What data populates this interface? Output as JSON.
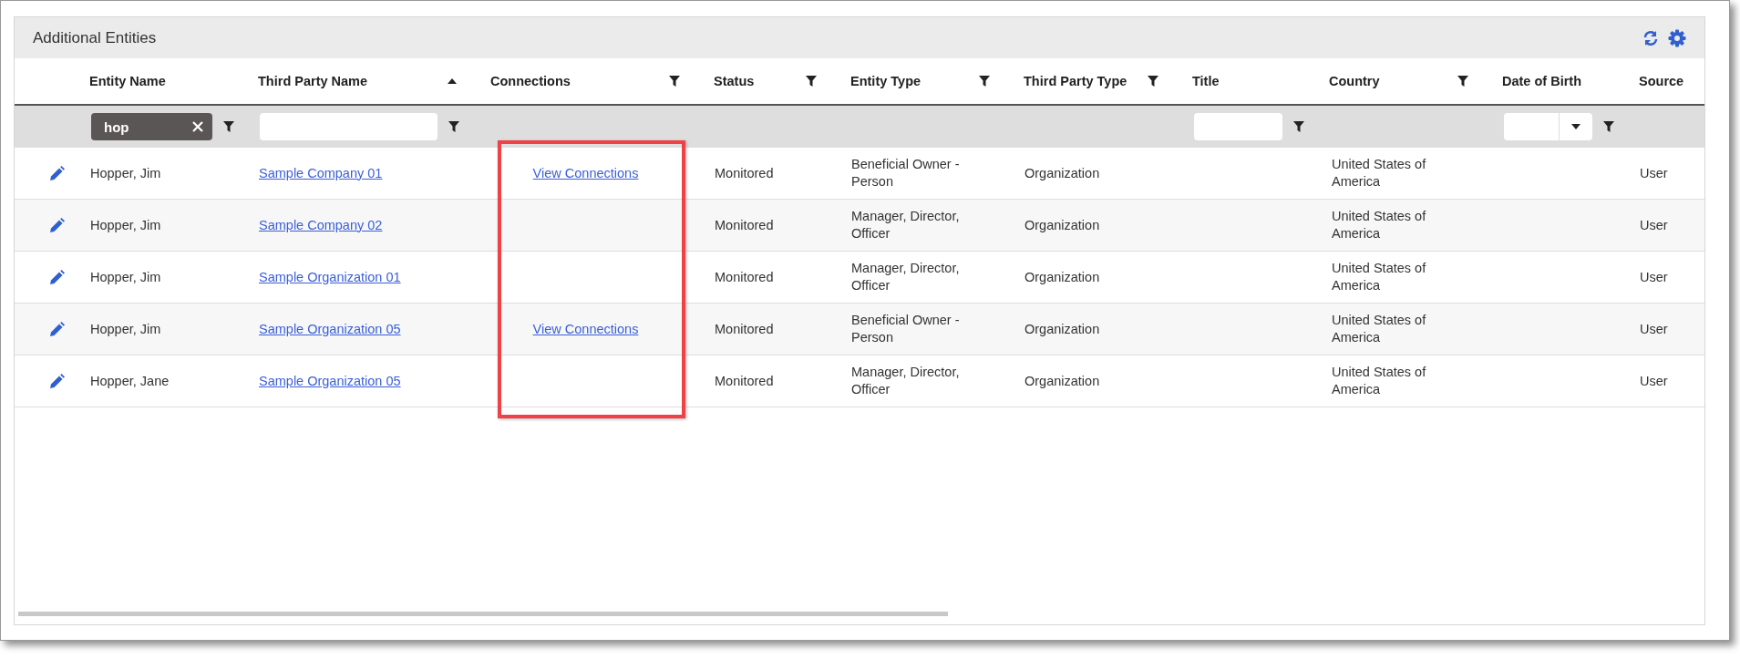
{
  "panel": {
    "title": "Additional Entities"
  },
  "columns": [
    {
      "label": "Entity Name",
      "filter": false,
      "sorted": false,
      "filter_input": {
        "kind": "chip",
        "value": "hop"
      }
    },
    {
      "label": "Third Party Name",
      "filter": false,
      "sorted": true,
      "filter_input": {
        "kind": "text"
      }
    },
    {
      "label": "Connections",
      "filter": true,
      "sorted": false
    },
    {
      "label": "Status",
      "filter": true,
      "sorted": false
    },
    {
      "label": "Entity Type",
      "filter": true,
      "sorted": false
    },
    {
      "label": "Third Party Type",
      "filter": true,
      "sorted": false
    },
    {
      "label": "Title",
      "filter": false,
      "sorted": false,
      "filter_input": {
        "kind": "text"
      }
    },
    {
      "label": "Country",
      "filter": true,
      "sorted": false
    },
    {
      "label": "Date of Birth",
      "filter": false,
      "sorted": false,
      "filter_input": {
        "kind": "dropdown"
      }
    },
    {
      "label": "Source",
      "filter": false,
      "sorted": false
    }
  ],
  "rows": [
    {
      "entity_name": "Hopper, Jim",
      "third_party_name": "Sample Company 01",
      "connections": "View Connections",
      "status": "Monitored",
      "entity_type": "Beneficial Owner - Person",
      "third_party_type": "Organization",
      "country": "United States of America",
      "source": "User"
    },
    {
      "entity_name": "Hopper, Jim",
      "third_party_name": "Sample Company 02",
      "status": "Monitored",
      "entity_type": "Manager, Director, Officer",
      "third_party_type": "Organization",
      "country": "United States of America",
      "source": "User"
    },
    {
      "entity_name": "Hopper, Jim",
      "third_party_name": "Sample Organization 01",
      "status": "Monitored",
      "entity_type": "Manager, Director, Officer",
      "third_party_type": "Organization",
      "country": "United States of America",
      "source": "User"
    },
    {
      "entity_name": "Hopper, Jim",
      "third_party_name": "Sample Organization 05",
      "connections": "View Connections",
      "status": "Monitored",
      "entity_type": "Beneficial Owner - Person",
      "third_party_type": "Organization",
      "country": "United States of America",
      "source": "User"
    },
    {
      "entity_name": "Hopper, Jane",
      "third_party_name": "Sample Organization 05",
      "status": "Monitored",
      "entity_type": "Manager, Director, Officer",
      "third_party_type": "Organization",
      "country": "United States of America",
      "source": "User"
    }
  ],
  "annotation": {
    "kind": "highlight-box"
  }
}
